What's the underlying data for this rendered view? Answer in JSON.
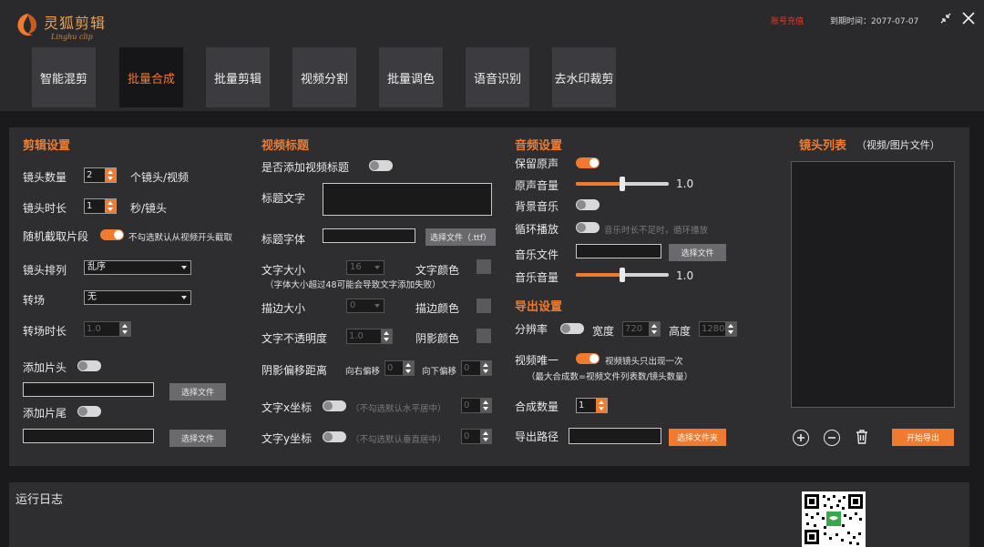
{
  "app": {
    "logo_cn": "灵狐剪辑",
    "logo_en": "Linghu clip",
    "account_link": "账号充值",
    "expiry": "到期时间：2077-07-07"
  },
  "tabs": [
    "智能混剪",
    "批量合成",
    "批量剪辑",
    "视频分割",
    "批量调色",
    "语音识别",
    "去水印裁剪"
  ],
  "edit": {
    "title": "剪辑设置",
    "shot_count_label": "镜头数量",
    "shot_count_value": "2",
    "shot_count_unit": "个镜头/视频",
    "shot_duration_label": "镜头时长",
    "shot_duration_value": "1",
    "shot_duration_unit": "秒/镜头",
    "random_label": "随机截取片段",
    "random_hint": "不勾选默认从视频开头截取",
    "order_label": "镜头排列",
    "order_value": "乱序",
    "transition_label": "转场",
    "transition_value": "无",
    "transition_dur_label": "转场时长",
    "transition_dur_value": "1.0",
    "head_label": "添加片头",
    "tail_label": "添加片尾",
    "choose_file": "选择文件"
  },
  "video_title": {
    "title": "视频标题",
    "add_label": "是否添加视频标题",
    "text_label": "标题文字",
    "font_label": "标题字体",
    "font_btn": "选择文件（.ttf）",
    "size_label": "文字大小",
    "size_value": "16",
    "color_label": "文字颜色",
    "size_note": "（字体大小超过48可能会导致文字添加失败）",
    "stroke_label": "描边大小",
    "stroke_value": "0",
    "stroke_color_label": "描边颜色",
    "opacity_label": "文字不透明度",
    "opacity_value": "1.0",
    "shadow_color_label": "阴影颜色",
    "shadow_offset_label": "阴影偏移距离",
    "right_offset_label": "向右偏移",
    "right_offset_value": "0",
    "down_offset_label": "向下偏移",
    "down_offset_value": "0",
    "x_label": "文字x坐标",
    "x_hint": "（不勾选默认水平居中）",
    "x_value": "0",
    "y_label": "文字y坐标",
    "y_hint": "（不勾选默认垂直居中）",
    "y_value": "0"
  },
  "audio": {
    "title": "音频设置",
    "keep_original_label": "保留原声",
    "original_volume_label": "原声音量",
    "original_volume_value": "1.0",
    "original_volume_level": 0.5,
    "bgm_label": "背景音乐",
    "loop_label": "循环播放",
    "loop_hint": "音乐时长不足时，循环播放",
    "music_file_label": "音乐文件",
    "choose_file": "选择文件",
    "music_volume_label": "音乐音量",
    "music_volume_value": "1.0",
    "music_volume_level": 0.5
  },
  "export": {
    "title": "导出设置",
    "resolution_label": "分辨率",
    "width_label": "宽度",
    "width_value": "720",
    "height_label": "高度",
    "height_value": "1280",
    "unique_label": "视频唯一",
    "unique_hint": "视频镜头只出现一次",
    "unique_note": "（最大合成数=视频文件列表数/镜头数量）",
    "count_label": "合成数量",
    "count_value": "1",
    "path_label": "导出路径",
    "choose_folder": "选择文件夹"
  },
  "shot_list": {
    "title": "镜头列表",
    "subtitle": "（视频/图片文件）",
    "add_icon": "plus-circle-icon",
    "remove_icon": "minus-circle-icon",
    "delete_icon": "trash-icon",
    "start_btn": "开始导出"
  },
  "log": {
    "title": "运行日志"
  },
  "colors": {
    "accent": "#f07a2e",
    "panel": "#2e2e31",
    "background": "#1a1a1c",
    "link_red": "#e03c2c"
  }
}
